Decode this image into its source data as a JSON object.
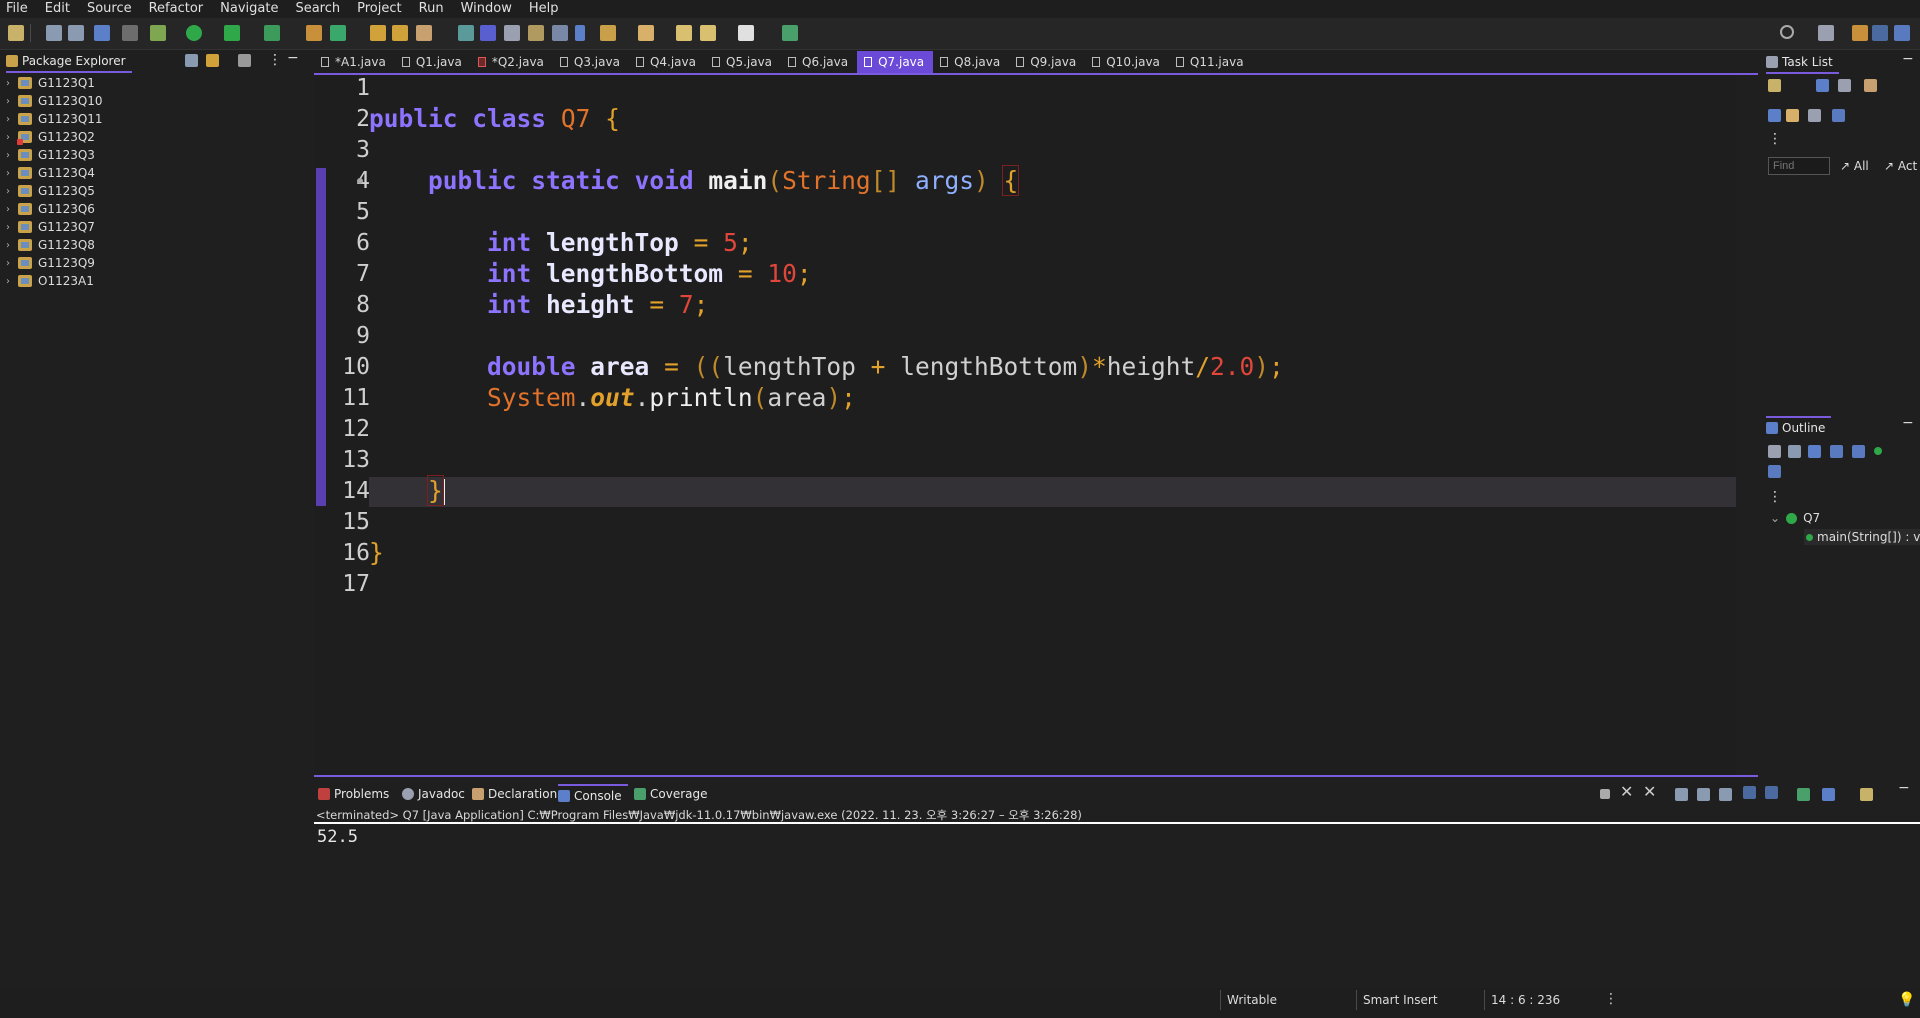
{
  "menu": [
    "File",
    "Edit",
    "Source",
    "Refactor",
    "Navigate",
    "Search",
    "Project",
    "Run",
    "Window",
    "Help"
  ],
  "package_explorer": {
    "title": "Package Explorer",
    "items": [
      {
        "label": "G1123Q1",
        "error": false
      },
      {
        "label": "G1123Q10",
        "error": false
      },
      {
        "label": "G1123Q11",
        "error": false
      },
      {
        "label": "G1123Q2",
        "error": true
      },
      {
        "label": "G1123Q3",
        "error": false
      },
      {
        "label": "G1123Q4",
        "error": false
      },
      {
        "label": "G1123Q5",
        "error": false
      },
      {
        "label": "G1123Q6",
        "error": false
      },
      {
        "label": "G1123Q7",
        "error": false
      },
      {
        "label": "G1123Q8",
        "error": false
      },
      {
        "label": "G1123Q9",
        "error": false
      },
      {
        "label": "O1123A1",
        "error": false
      }
    ]
  },
  "editor_tabs": [
    {
      "label": "*A1.java",
      "error": false,
      "active": false
    },
    {
      "label": "Q1.java",
      "error": false,
      "active": false
    },
    {
      "label": "*Q2.java",
      "error": true,
      "active": false
    },
    {
      "label": "Q3.java",
      "error": false,
      "active": false
    },
    {
      "label": "Q4.java",
      "error": false,
      "active": false
    },
    {
      "label": "Q5.java",
      "error": false,
      "active": false
    },
    {
      "label": "Q6.java",
      "error": false,
      "active": false
    },
    {
      "label": "Q7.java",
      "error": false,
      "active": true
    },
    {
      "label": "Q8.java",
      "error": false,
      "active": false
    },
    {
      "label": "Q9.java",
      "error": false,
      "active": false
    },
    {
      "label": "Q10.java",
      "error": false,
      "active": false
    },
    {
      "label": "Q11.java",
      "error": false,
      "active": false
    }
  ],
  "editor": {
    "line_numbers": [
      "1",
      "2",
      "3",
      "4",
      "5",
      "6",
      "7",
      "8",
      "9",
      "10",
      "11",
      "12",
      "13",
      "14",
      "15",
      "16",
      "17"
    ],
    "code": {
      "l2": {
        "kw1": "public",
        "kw2": "class",
        "cls": "Q7",
        "brace": "{"
      },
      "l4": {
        "kw1": "public",
        "kw2": "static",
        "kw3": "void",
        "method": "main",
        "p1": "(",
        "type": "String",
        "arr": "[]",
        "arg": "args",
        "p2": ")",
        "brace": "{"
      },
      "l6": {
        "kw": "int",
        "var": "lengthTop",
        "eq": "=",
        "num": "5",
        "semi": ";"
      },
      "l7": {
        "kw": "int",
        "var": "lengthBottom",
        "eq": "=",
        "num": "10",
        "semi": ";"
      },
      "l8": {
        "kw": "int",
        "var": "height",
        "eq": "=",
        "num": "7",
        "semi": ";"
      },
      "l10": {
        "kw": "double",
        "var": "area",
        "eq": "=",
        "p1": "((",
        "a": "lengthTop",
        "plus": "+",
        "b": "lengthBottom",
        "p2": ")",
        "mul": "*",
        "c": "height",
        "div": "/",
        "num": "2.0",
        "p3": ")",
        "semi": ";"
      },
      "l11": {
        "sys": "System",
        "dot1": ".",
        "field": "out",
        "dot2": ".",
        "method": "println",
        "p1": "(",
        "arg": "area",
        "p2": ")",
        "semi": ";"
      },
      "l14": {
        "brace": "}"
      },
      "l16": {
        "brace": "}"
      }
    }
  },
  "task_list": {
    "title": "Task List",
    "find_placeholder": "Find",
    "all": "All",
    "act": "Act"
  },
  "outline": {
    "title": "Outline",
    "class_node": "Q7",
    "method_node": "main(String[]) : v"
  },
  "bottom_tabs": [
    "Problems",
    "Javadoc",
    "Declaration",
    "Console",
    "Coverage"
  ],
  "console": {
    "description": "<terminated> Q7 [Java Application] C:₩Program Files₩Java₩jdk-11.0.17₩bin₩javaw.exe  (2022. 11. 23. 오후 3:26:27 – 오후 3:26:28)",
    "output": "52.5"
  },
  "status": {
    "writable": "Writable",
    "insert_mode": "Smart Insert",
    "position": "14 : 6 : 236"
  },
  "colors": {
    "accent": "#7a5bde",
    "active_tab": "#6a4ad6"
  }
}
